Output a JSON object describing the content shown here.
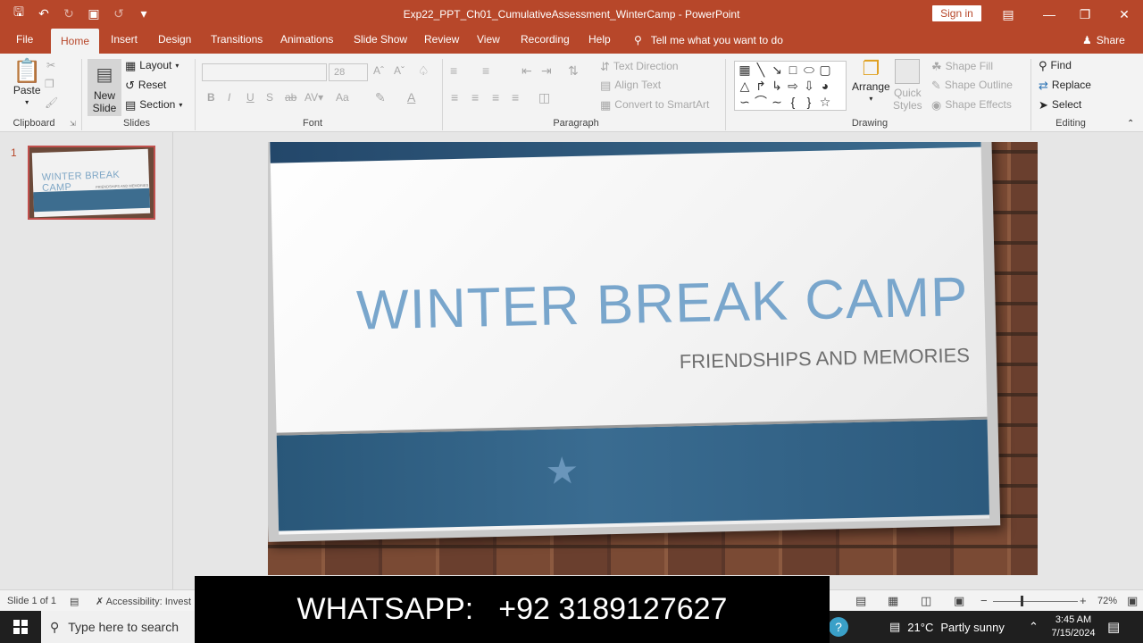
{
  "window": {
    "title": "Exp22_PPT_Ch01_CumulativeAssessment_WinterCamp  -  PowerPoint",
    "sign_in": "Sign in"
  },
  "tabs": [
    "File",
    "Home",
    "Insert",
    "Design",
    "Transitions",
    "Animations",
    "Slide Show",
    "Review",
    "View",
    "Recording",
    "Help"
  ],
  "active_tab": "Home",
  "tell_me": "Tell me what you want to do",
  "share": "Share",
  "ribbon": {
    "clipboard": {
      "label": "Clipboard",
      "paste": "Paste"
    },
    "slides": {
      "label": "Slides",
      "new_slide_1": "New",
      "new_slide_2": "Slide",
      "layout": "Layout",
      "reset": "Reset",
      "section": "Section"
    },
    "font": {
      "label": "Font",
      "font_size": "28",
      "bold": "B",
      "italic": "I",
      "underline": "U",
      "strike": "S",
      "case": "Aa"
    },
    "paragraph": {
      "label": "Paragraph",
      "text_direction": "Text Direction",
      "align_text": "Align Text",
      "convert_smartart": "Convert to SmartArt"
    },
    "drawing": {
      "label": "Drawing",
      "arrange": "Arrange",
      "quick_styles_1": "Quick",
      "quick_styles_2": "Styles",
      "shape_fill": "Shape Fill",
      "shape_outline": "Shape Outline",
      "shape_effects": "Shape Effects"
    },
    "editing": {
      "label": "Editing",
      "find": "Find",
      "replace": "Replace",
      "select": "Select"
    }
  },
  "thumbnails": [
    {
      "number": "1",
      "title": "WINTER BREAK CAMP",
      "subtitle": "FRIENDSHIPS AND MEMORIES"
    }
  ],
  "slide": {
    "title": "WINTER BREAK CAMP",
    "subtitle": "FRIENDSHIPS AND MEMORIES"
  },
  "status": {
    "slide_count": "Slide 1 of 1",
    "accessibility": "Accessibility: Invest",
    "zoom": "72%"
  },
  "overlay": {
    "label": "WHATSAPP:",
    "number": "+92 3189127627"
  },
  "taskbar": {
    "search_placeholder": "Type here to search",
    "weather_temp": "21°C",
    "weather_desc": "Partly sunny",
    "time": "3:45 AM",
    "date": "7/15/2024"
  },
  "colors": {
    "accent": "#b7472a",
    "slide_title": "#79a6cc",
    "band": "#3a6c91"
  }
}
